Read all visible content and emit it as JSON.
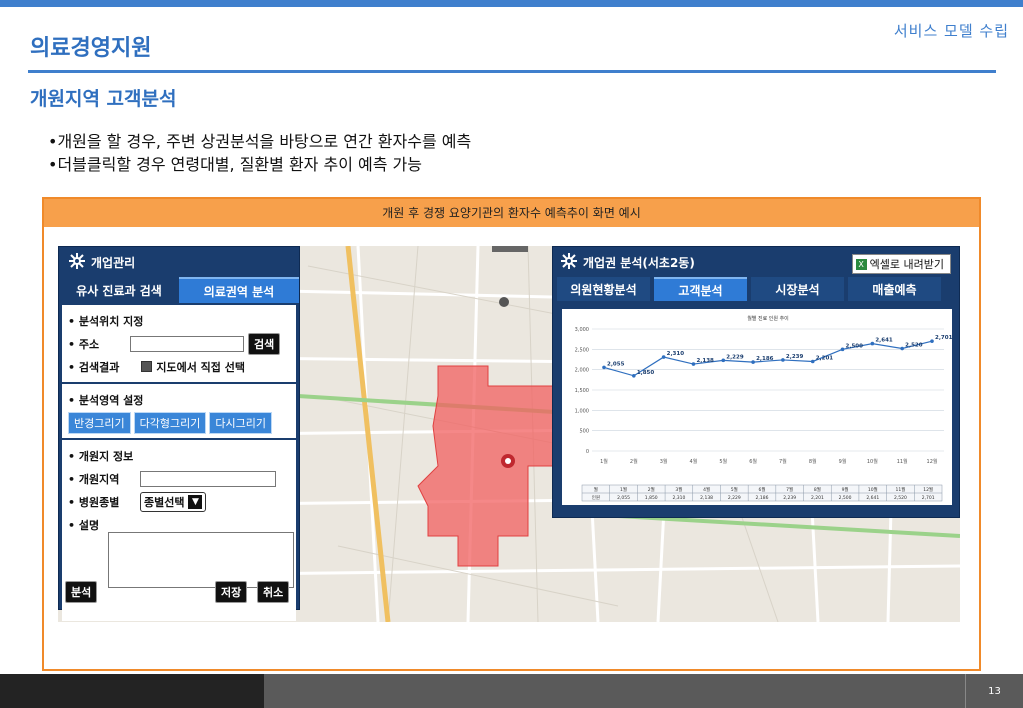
{
  "header": {
    "right_label": "서비스 모델 수립",
    "org_title": "의료경영지원",
    "sub_title": "개원지역 고객분석"
  },
  "bullets": [
    "•개원을 할 경우, 주변 상권분석을 바탕으로 연간 환자수를 예측",
    "•더블클릭할 경우 연령대별, 질환별 환자 추이 예측 가능"
  ],
  "frame": {
    "caption": "개원 후 경쟁 요양기관의 환자수 예측추이 화면 예시"
  },
  "left_panel": {
    "title": "개업관리",
    "tabs": [
      {
        "label": "유사 진료과 검색",
        "active": false
      },
      {
        "label": "의료권역 분석",
        "active": true
      }
    ],
    "location": {
      "heading": "• 분석위치 지정",
      "address_label": "• 주소",
      "search_button": "검색",
      "result_label": "• 검색결과",
      "map_select_label": "지도에서 직접  선택"
    },
    "area": {
      "heading": "• 분석영역 설정",
      "buttons": [
        "반경그리기",
        "다각형그리기",
        "다시그리기"
      ]
    },
    "info": {
      "heading": "• 개원지 정보",
      "region_label": "• 개원지역",
      "type_label": "• 병원종별",
      "type_select": "종별선택",
      "desc_label": "• 설명"
    },
    "footer": {
      "analyze_button": "분석",
      "save_button": "저장",
      "cancel_button": "취소"
    }
  },
  "right_panel": {
    "title": "개업권 분석(서초2동)",
    "excel_button": "엑셀로 내려받기",
    "tabs": [
      {
        "label": "의원현황분석",
        "active": false
      },
      {
        "label": "고객분석",
        "active": true
      },
      {
        "label": "시장분석",
        "active": false
      },
      {
        "label": "매출예측",
        "active": false
      }
    ]
  },
  "chart_data": {
    "type": "line",
    "title": "월별 진료 인원 추이",
    "categories": [
      "1월",
      "2월",
      "3월",
      "4월",
      "5월",
      "6월",
      "7월",
      "8월",
      "9월",
      "10월",
      "11월",
      "12월"
    ],
    "series": [
      {
        "name": "인원",
        "values": [
          2055,
          1850,
          2310,
          2138,
          2229,
          2186,
          2239,
          2201,
          2500,
          2641,
          2520,
          2701
        ]
      }
    ],
    "value_labels": [
      "2,055",
      "1,850",
      "2,310",
      "2,138",
      "2,229",
      "2,186",
      "2,239",
      "2,201",
      "2,500",
      "2,641",
      "2,520",
      "2,701"
    ],
    "y_ticks": [
      "0",
      "500",
      "1,000",
      "1,500",
      "2,000",
      "2,500",
      "3,000"
    ],
    "ylim": [
      0,
      3000
    ],
    "table_header": "월",
    "table_row_label": "인원",
    "line_color": "#2f6fbf",
    "grid": true
  },
  "footer": {
    "page_number": "13"
  }
}
